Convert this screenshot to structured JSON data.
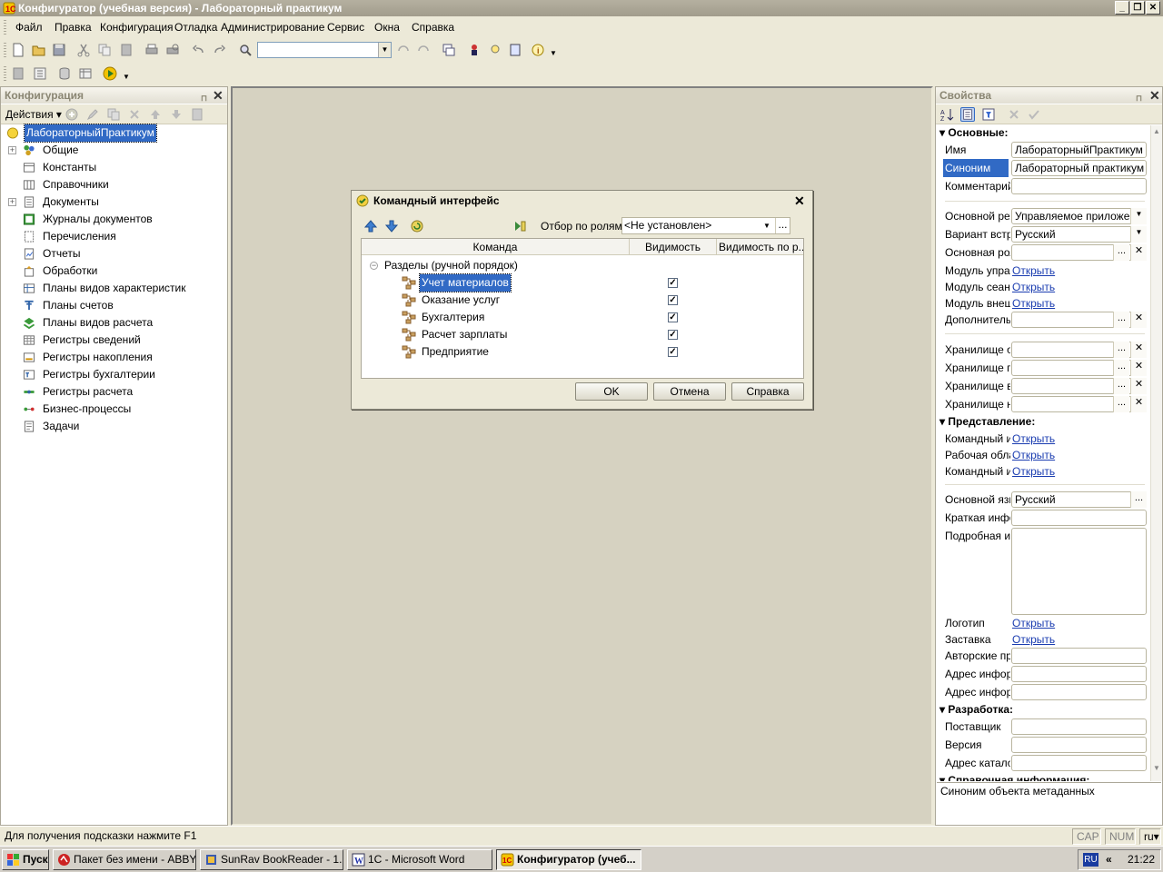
{
  "window": {
    "title": "Конфигуратор (учебная версия) - Лабораторный практикум"
  },
  "menu": [
    "Файл",
    "Правка",
    "Конфигурация",
    "Отладка",
    "Администрирование",
    "Сервис",
    "Окна",
    "Справка"
  ],
  "config_panel": {
    "title": "Конфигурация",
    "actions_label": "Действия",
    "tree": [
      {
        "label": "ЛабораторныйПрактикум",
        "icon": "config-root-icon",
        "selected": true
      },
      {
        "label": "Общие",
        "icon": "common-icon",
        "expandable": true
      },
      {
        "label": "Константы",
        "icon": "constants-icon"
      },
      {
        "label": "Справочники",
        "icon": "catalogs-icon"
      },
      {
        "label": "Документы",
        "icon": "documents-icon",
        "expandable": true
      },
      {
        "label": "Журналы документов",
        "icon": "journals-icon"
      },
      {
        "label": "Перечисления",
        "icon": "enums-icon"
      },
      {
        "label": "Отчеты",
        "icon": "reports-icon"
      },
      {
        "label": "Обработки",
        "icon": "processing-icon"
      },
      {
        "label": "Планы видов характеристик",
        "icon": "char-types-icon"
      },
      {
        "label": "Планы счетов",
        "icon": "accounts-icon"
      },
      {
        "label": "Планы видов расчета",
        "icon": "calc-types-icon"
      },
      {
        "label": "Регистры сведений",
        "icon": "info-registers-icon"
      },
      {
        "label": "Регистры накопления",
        "icon": "accum-registers-icon"
      },
      {
        "label": "Регистры бухгалтерии",
        "icon": "account-registers-icon"
      },
      {
        "label": "Регистры расчета",
        "icon": "calc-registers-icon"
      },
      {
        "label": "Бизнес-процессы",
        "icon": "business-process-icon"
      },
      {
        "label": "Задачи",
        "icon": "tasks-icon"
      }
    ]
  },
  "dialog": {
    "title": "Командный интерфейс",
    "filter_label": "Отбор по ролям:",
    "filter_value": "<Не установлен>",
    "columns": [
      "Команда",
      "Видимость",
      "Видимость по р..."
    ],
    "group": "Разделы (ручной порядок)",
    "rows": [
      {
        "label": "Учет материалов",
        "visible": true,
        "selected": true
      },
      {
        "label": "Оказание услуг",
        "visible": true
      },
      {
        "label": "Бухгалтерия",
        "visible": true
      },
      {
        "label": "Расчет зарплаты",
        "visible": true
      },
      {
        "label": "Предприятие",
        "visible": true
      }
    ],
    "buttons": {
      "ok": "OK",
      "cancel": "Отмена",
      "help": "Справка"
    }
  },
  "properties": {
    "title": "Свойства",
    "group_main": "Основные:",
    "name_label": "Имя",
    "name_value": "ЛабораторныйПрактикум",
    "synonym_label": "Синоним",
    "synonym_value": "Лабораторный практикум",
    "comment_label": "Комментарий",
    "comment_value": "",
    "main_mode_label": "Основной реж",
    "main_mode_value": "Управляемое приложени",
    "compat_label": "Вариант встро",
    "compat_value": "Русский",
    "main_role_label": "Основная рол",
    "main_role_value": "",
    "mod_app_label": "Модуль управ",
    "mod_session_label": "Модуль сеанс",
    "mod_ext_label": "Модуль внеш",
    "open_link": "Открыть",
    "additional_label": "Дополнителы",
    "storage1_label": "Хранилище об",
    "storage2_label": "Хранилище по",
    "storage3_label": "Хранилище ва",
    "storage4_label": "Хранилище на",
    "group_presentation": "Представление:",
    "cmd1_label": "Командный и",
    "work_label": "Рабочая обла",
    "cmd2_label": "Командный и",
    "lang_label": "Основной язь",
    "lang_value": "Русский",
    "brief_label": "Краткая инфо",
    "brief_value": "",
    "detailed_label": "Подробная ин",
    "detailed_value": "",
    "logo_label": "Логотип",
    "splash_label": "Заставка",
    "copyright_label": "Авторские пр",
    "addr1_label": "Адрес инфорг",
    "addr1_value": "",
    "addr2_label": "Адрес инфорг",
    "addr2_value": "",
    "group_dev": "Разработка:",
    "vendor_label": "Поставщик",
    "vendor_value": "",
    "version_label": "Версия",
    "version_value": "",
    "catalog_label": "Адрес катало",
    "catalog_value": "",
    "group_ref_partial": "Справочная информация:",
    "description": "Синоним объекта метаданных"
  },
  "status": {
    "hint": "Для получения подсказки нажмите F1",
    "cap": "CAP",
    "num": "NUM",
    "lang": "ru"
  },
  "taskbar": {
    "start": "Пуск",
    "tasks": [
      "Пакет без имени - ABBY...",
      "SunRav BookReader - 1...",
      "1С - Microsoft Word",
      "Конфигуратор (учеб..."
    ],
    "lang": "RU",
    "chevron": "«",
    "time": "21:22"
  },
  "colors": {
    "selection": "#316ac5",
    "link": "#1a3cb0",
    "titlebar": "#a8a394"
  }
}
